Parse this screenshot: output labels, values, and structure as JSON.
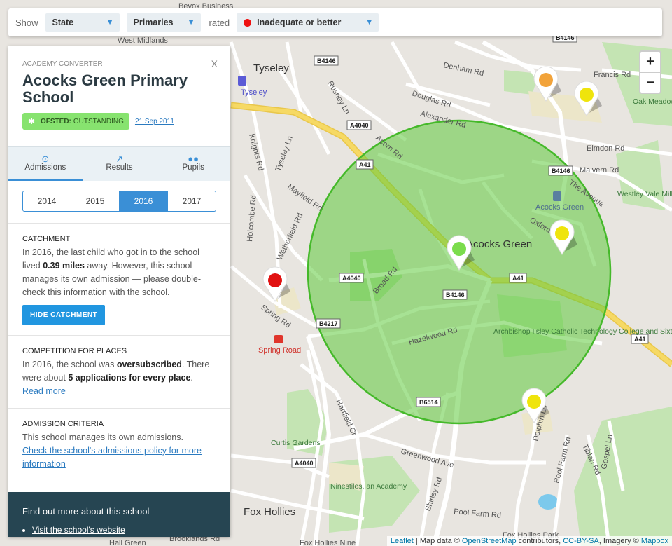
{
  "filter": {
    "show_label": "Show",
    "state_value": "State",
    "phase_value": "Primaries",
    "rated_label": "rated",
    "rating_value": "Inadequate or better",
    "rating_color": "#e11111"
  },
  "zoom": {
    "in": "+",
    "out": "−"
  },
  "attribution": {
    "leaflet": "Leaflet",
    "sep": " | Map data © ",
    "osm": "OpenStreetMap",
    "contrib": " contributors, ",
    "license": "CC-BY-SA",
    "imagery": ", Imagery © ",
    "mapbox": "Mapbox"
  },
  "map_labels": {
    "places": [
      "Tyseley",
      "Acocks Green",
      "Fox Hollies"
    ],
    "roads": [
      "Denham Rd",
      "Francis Rd",
      "Douglas Rd",
      "Alexander Rd",
      "Rushey Ln",
      "Elmdon Rd",
      "Malvern Rd",
      "The Avenue",
      "Oxford",
      "Acorn Rd",
      "Knights Rd",
      "Tyseley Ln",
      "Mayfield Rd",
      "Wetherfield Rd",
      "Holcombe Rd",
      "Spring Rd",
      "Broad Rd",
      "Hazelwood Rd",
      "Hartfield Cr",
      "Greenwood Ave",
      "Shirley Rd",
      "Dolphin Ln",
      "Pool Farm Rd",
      "Tiblan Rd",
      "Gospel Ln",
      "Pool Farm Rd",
      "Fox Hollies Park",
      "Brooklands Rd",
      "Hall Green",
      "Fox Hollies Nine",
      "West Midlands",
      "Bevox Business"
    ],
    "shields": [
      "B4146",
      "A4040",
      "A41",
      "B4146",
      "A4040",
      "B4217",
      "B4146",
      "A41",
      "A41",
      "B6514",
      "A4040",
      "B4146"
    ],
    "green": [
      "Westley Vale Millennium Green",
      "Oak Meadow Open Sp",
      "Curtis Gardens",
      "Ninestiles, an Academy",
      "Archbishop Ilsley Catholic Technology College and Sixth Form Centre"
    ],
    "stations": [
      "Tyseley",
      "Acocks Green",
      "Spring Road"
    ]
  },
  "markers": [
    {
      "color": "#e11111",
      "rating": "inadequate"
    },
    {
      "color": "#7bdc4c",
      "rating": "outstanding"
    },
    {
      "color": "#f2a33a",
      "rating": "requires improvement"
    },
    {
      "color": "#efe40c",
      "rating": "good"
    },
    {
      "color": "#efe40c",
      "rating": "good"
    },
    {
      "color": "#efe40c",
      "rating": "good"
    }
  ],
  "catchment_color": "#5ecb3d",
  "panel": {
    "type": "Academy Converter",
    "close": "X",
    "name": "Acocks Green Primary School",
    "ofsted_label": "OFSTED:",
    "ofsted_value": "OUTSTANDING",
    "ofsted_date": "21 Sep 2011",
    "tabs": [
      {
        "label": "Admissions",
        "icon": "clock-icon"
      },
      {
        "label": "Results",
        "icon": "trend-icon"
      },
      {
        "label": "Pupils",
        "icon": "people-icon"
      }
    ],
    "years": [
      "2014",
      "2015",
      "2016",
      "2017"
    ],
    "active_year": "2016",
    "catchment": {
      "heading": "CATCHMENT",
      "t1": "In 2016, the last child who got in to the school lived ",
      "distance": "0.39 miles",
      "t2": " away. However, this school manages its own admission — please double-check this information with the school.",
      "button": "HIDE CATCHMENT"
    },
    "competition": {
      "heading": "COMPETITION FOR PLACES",
      "t1": "In 2016, the school was ",
      "status": "oversubscribed",
      "t2": ". There were about ",
      "apps": "5 applications for every place",
      "t3": ".",
      "link": "Read more"
    },
    "criteria": {
      "heading": "ADMISSION CRITERIA",
      "text": "This school manages its own admissions.",
      "link": "Check the school's admissions policy for more information"
    },
    "findout": {
      "title": "Find out more about this school",
      "link": "Visit the school's website"
    }
  }
}
